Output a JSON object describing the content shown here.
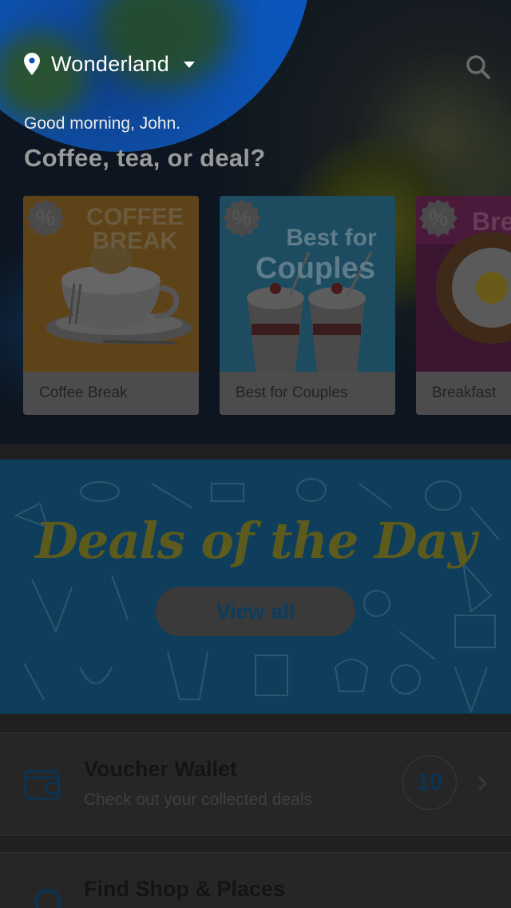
{
  "header": {
    "location": "Wonderland",
    "greeting": "Good morning, John.",
    "tagline": "Coffee, tea, or deal?"
  },
  "cards": [
    {
      "label": "Coffee Break",
      "image_title_line1": "COFFEE",
      "image_title_line2": "BREAK",
      "badge": "%"
    },
    {
      "label": "Best for Couples",
      "image_title_line1": "Best for",
      "image_title_line2": "Couples",
      "badge": "%"
    },
    {
      "label": "Breakfast",
      "image_title_line1": "Bre",
      "badge": "%"
    }
  ],
  "deals_banner": {
    "title": "Deals of the Day",
    "button_label": "View all"
  },
  "voucher_wallet": {
    "title": "Voucher Wallet",
    "subtitle": "Check out your collected deals",
    "count": "10"
  },
  "find_shop": {
    "title": "Find Shop & Places"
  },
  "colors": {
    "overlay_dark": "#1f1f1f",
    "bubble_blue": "#0c56bb",
    "deals_bg": "#0e3e5c",
    "accent_navy": "#0c3352"
  },
  "icons": [
    "location-pin-icon",
    "dropdown-caret-icon",
    "search-icon",
    "percent-badge-icon",
    "wallet-icon",
    "chevron-right-icon",
    "search-place-icon"
  ]
}
